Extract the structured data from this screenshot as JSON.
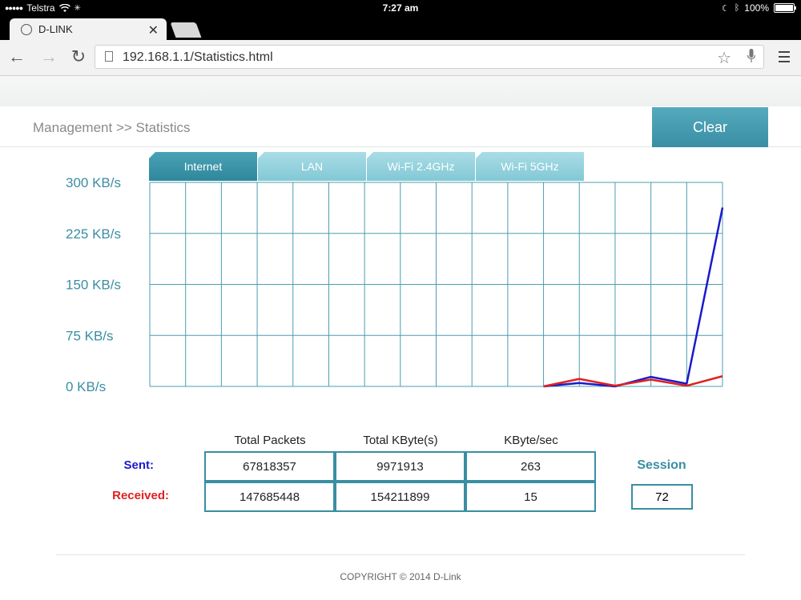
{
  "status_bar": {
    "signal_dots": "●●●●●",
    "carrier": "Telstra",
    "time": "7:27 am",
    "battery": "100%"
  },
  "browser": {
    "tab_title": "D-LINK",
    "url": "192.168.1.1/Statistics.html"
  },
  "page": {
    "breadcrumb": "Management >> Statistics",
    "clear_label": "Clear",
    "tabs": [
      {
        "label": "Internet",
        "active": true
      },
      {
        "label": "LAN",
        "active": false
      },
      {
        "label": "Wi-Fi 2.4GHz",
        "active": false
      },
      {
        "label": "Wi-Fi 5GHz",
        "active": false
      }
    ],
    "table": {
      "headers": [
        "Total Packets",
        "Total KByte(s)",
        "KByte/sec"
      ],
      "sent_label": "Sent:",
      "received_label": "Received:",
      "sent": [
        "67818357",
        "9971913",
        "263"
      ],
      "received": [
        "147685448",
        "154211899",
        "15"
      ],
      "session_label": "Session",
      "session_value": "72"
    },
    "copyright": "COPYRIGHT © 2014 D-Link"
  },
  "colors": {
    "accent": "#3a8ea3",
    "sent": "#1a1acc",
    "received": "#e02020"
  },
  "chart_data": {
    "type": "line",
    "y_tick_labels": [
      "300 KB/s",
      "225 KB/s",
      "150 KB/s",
      "75 KB/s",
      "0 KB/s"
    ],
    "ylim": [
      0,
      300
    ],
    "x": [
      0,
      1,
      2,
      3,
      4,
      5,
      6,
      7,
      8,
      9,
      10,
      11,
      12,
      13,
      14,
      15,
      16
    ],
    "series": [
      {
        "values": [
          null,
          null,
          null,
          null,
          null,
          null,
          null,
          null,
          null,
          null,
          null,
          0,
          5,
          0,
          14,
          4,
          263
        ],
        "color": "#1a1acc"
      },
      {
        "values": [
          null,
          null,
          null,
          null,
          null,
          null,
          null,
          null,
          null,
          null,
          null,
          0,
          11,
          1,
          10,
          1,
          15
        ],
        "color": "#e02020"
      }
    ],
    "grid": true
  }
}
